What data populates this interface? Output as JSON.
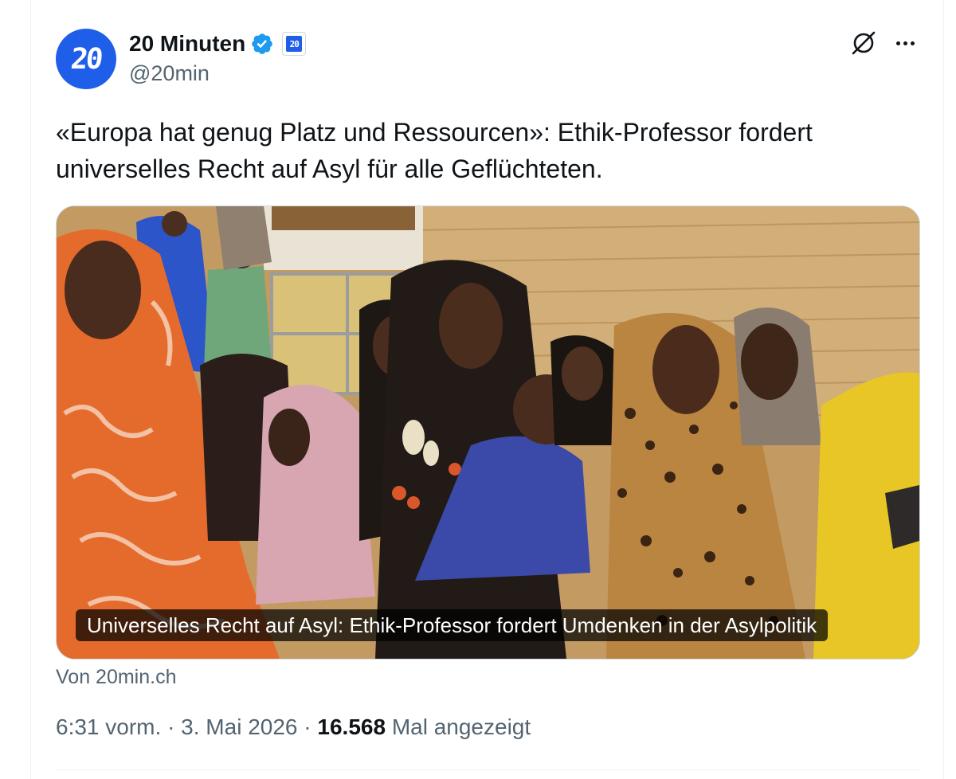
{
  "author": {
    "avatar_text": "20",
    "display_name": "20 Minuten",
    "handle": "@20min",
    "affiliate_badge_text": "20",
    "verified": true
  },
  "tweet": {
    "text": "«Europa hat genug Platz und Ressourcen»: Ethik-Professor fordert universelles Recht auf Asyl für alle Geflüchteten."
  },
  "card": {
    "caption": "Universelles Recht auf Asyl: Ethik-Professor fordert Umdenken in der Asylpolitik",
    "source": "Von 20min.ch"
  },
  "meta": {
    "time": "6:31 vorm.",
    "separator": "·",
    "date": "3. Mai 2026",
    "views_count": "16.568",
    "views_label": "Mal angezeigt"
  },
  "colors": {
    "brand_blue": "#1f5ee8",
    "verified_blue": "#1d9bf0",
    "muted_text": "#536471"
  },
  "icons": {
    "grok": "grok-icon",
    "more": "more-icon",
    "verified": "verified-badge-icon"
  }
}
